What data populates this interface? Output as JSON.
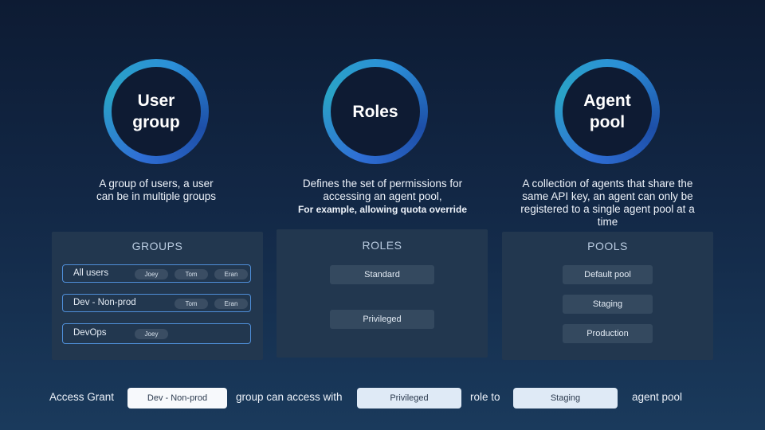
{
  "concepts": [
    {
      "title": "User\ngroup",
      "desc_lines": [
        "A group of users, a user",
        "can be in multiple groups"
      ]
    },
    {
      "title": "Roles",
      "desc_lines": [
        "Defines the set of permissions for",
        "accessing an agent pool,"
      ],
      "desc_bold": "For example, allowing quota override"
    },
    {
      "title": "Agent\npool",
      "desc_lines": [
        "A collection of agents that share the",
        "same API key, an agent can only be",
        "registered to a single agent pool at a",
        "time"
      ]
    }
  ],
  "groups_panel": {
    "title": "GROUPS",
    "rows": [
      {
        "name": "All users",
        "members": [
          "Joey",
          "Tom",
          "Eran"
        ]
      },
      {
        "name": "Dev - Non-prod",
        "members": [
          "Tom",
          "Eran"
        ]
      },
      {
        "name": "DevOps",
        "members": [
          "Joey"
        ]
      }
    ]
  },
  "roles_panel": {
    "title": "ROLES",
    "items": [
      "Standard",
      "Privileged"
    ]
  },
  "pools_panel": {
    "title": "POOLS",
    "items": [
      "Default pool",
      "Staging",
      "Production"
    ]
  },
  "access_grant": {
    "label": "Access Grant",
    "group_value": "Dev - Non-prod",
    "text_1": "group can access with",
    "role_value": "Privileged",
    "text_2": "role to",
    "pool_value": "Staging",
    "text_3": "agent pool"
  },
  "colors": {
    "ring_start": "#2f6fd6",
    "ring_end": "#2aa3c6",
    "panel_bg": "#22374f",
    "group_border": "#4f8fd9"
  }
}
